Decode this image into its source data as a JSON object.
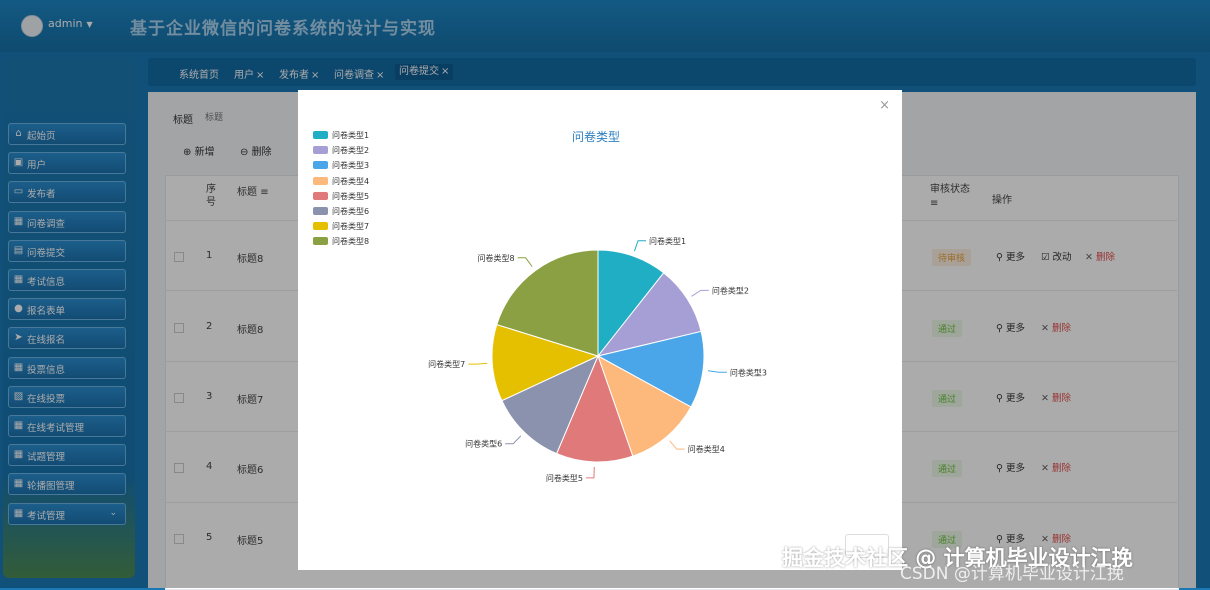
{
  "header": {
    "user": "admin",
    "app_title": "基于企业微信的问卷系统的设计与实现"
  },
  "sidebar": {
    "items": [
      {
        "label": "起始页",
        "icon": "home-icon"
      },
      {
        "label": "用户",
        "icon": "user-icon"
      },
      {
        "label": "发布者",
        "icon": "monitor-icon"
      },
      {
        "label": "问卷调查",
        "icon": "grid-icon"
      },
      {
        "label": "问卷提交",
        "icon": "clipboard-icon"
      },
      {
        "label": "考试信息",
        "icon": "grid-icon"
      },
      {
        "label": "报名表单",
        "icon": "person-icon"
      },
      {
        "label": "在线报名",
        "icon": "send-icon"
      },
      {
        "label": "投票信息",
        "icon": "grid-icon"
      },
      {
        "label": "在线投票",
        "icon": "chart-icon"
      },
      {
        "label": "在线考试管理",
        "icon": "grid-icon"
      },
      {
        "label": "试题管理",
        "icon": "grid-icon"
      },
      {
        "label": "轮播图管理",
        "icon": "grid-icon"
      },
      {
        "label": "考试管理",
        "icon": "grid-icon"
      }
    ]
  },
  "breadcrumbs": [
    {
      "label": "系统首页"
    },
    {
      "label": "用户",
      "close": "×"
    },
    {
      "label": "发布者",
      "close": "×"
    },
    {
      "label": "问卷调查",
      "close": "×"
    },
    {
      "label": "问卷提交",
      "close": "×"
    }
  ],
  "search": {
    "label": "标题",
    "placeholder": "标题"
  },
  "toolbar": {
    "add_label": "新增",
    "delete_label": "删除"
  },
  "table": {
    "headers": {
      "index": "序号",
      "title": "标题",
      "status": "审核状态",
      "ops": "操作"
    },
    "rows": [
      {
        "index": "1",
        "title": "标题8",
        "status": "待审核",
        "status_type": "pending"
      },
      {
        "index": "2",
        "title": "标题8",
        "status": "通过",
        "status_type": "pass"
      },
      {
        "index": "3",
        "title": "标题7",
        "status": "通过",
        "status_type": "pass"
      },
      {
        "index": "4",
        "title": "标题6",
        "status": "通过",
        "status_type": "pass"
      },
      {
        "index": "5",
        "title": "标题5",
        "status": "通过",
        "status_type": "pass"
      }
    ],
    "ops": {
      "more": "更多",
      "edit": "改动",
      "delete": "删除"
    }
  },
  "modal": {
    "close": "×"
  },
  "chart_data": {
    "type": "pie",
    "title": "问卷类型",
    "legend_position": "top-left",
    "categories": [
      "问卷类型1",
      "问卷类型2",
      "问卷类型3",
      "问卷类型4",
      "问卷类型5",
      "问卷类型6",
      "问卷类型7",
      "问卷类型8"
    ],
    "values": [
      10,
      10,
      11,
      11,
      11,
      11,
      11,
      19
    ],
    "colors": [
      "#1faec3",
      "#a69fd6",
      "#4aa6e8",
      "#fdb87c",
      "#e07a7a",
      "#8b92ad",
      "#e5c000",
      "#8aa042"
    ]
  },
  "watermark": {
    "line1": "掘金技术社区 @ 计算机毕业设计江挽",
    "line2": "CSDN @计算机毕业设计江挽"
  }
}
